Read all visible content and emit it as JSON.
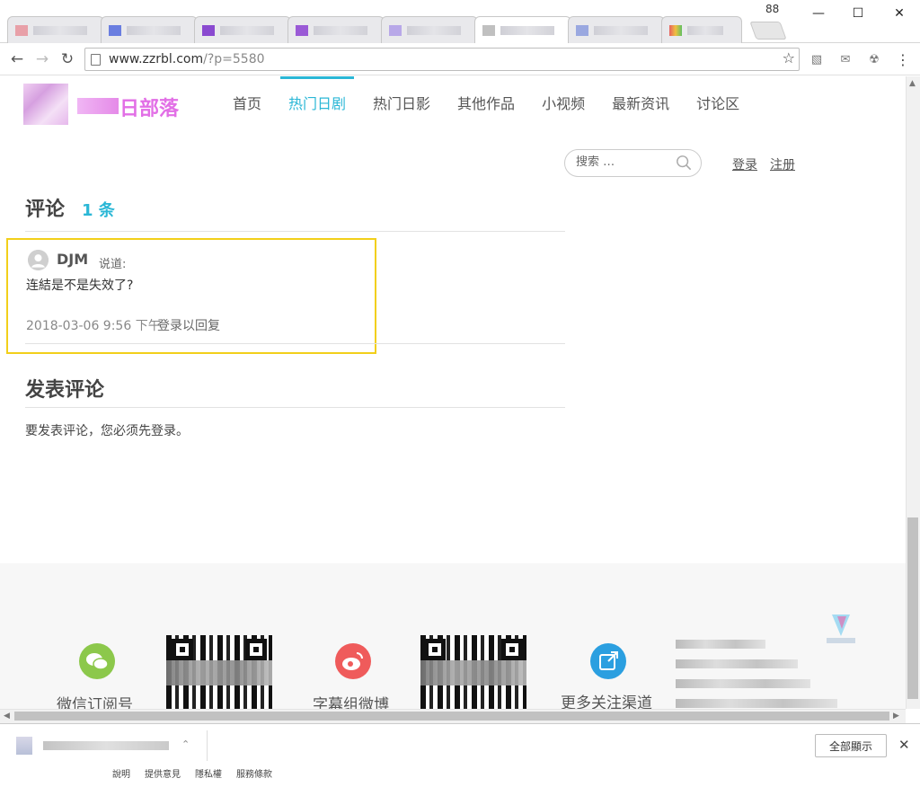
{
  "browser": {
    "tab_count": "88",
    "url_host": "www.zzrbl.com",
    "url_path": "/?p=5580",
    "window_controls": {
      "minimize_icon": "minimize-icon",
      "maximize_icon": "maximize-icon",
      "close_icon": "close-icon"
    }
  },
  "site": {
    "logo_text": "日部落",
    "nav": [
      {
        "label": "首页",
        "active": false
      },
      {
        "label": "热门日剧",
        "active": true
      },
      {
        "label": "热门日影",
        "active": false
      },
      {
        "label": "其他作品",
        "active": false
      },
      {
        "label": "小视频",
        "active": false
      },
      {
        "label": "最新资讯",
        "active": false
      },
      {
        "label": "讨论区",
        "active": false
      }
    ],
    "accent_color": "#2bb7d6",
    "logo_color": "#e26fe6"
  },
  "search": {
    "placeholder": "搜索 …"
  },
  "auth": {
    "login": "登录",
    "register": "注册"
  },
  "comments": {
    "title": "评论",
    "count": "1 条",
    "items": [
      {
        "author": "DJM",
        "says": "说道:",
        "body": "连結是不是失效了?",
        "date": "2018-03-06 9:56 下午",
        "reply": "登录以回复"
      }
    ],
    "highlight_color": "#f2cf1a"
  },
  "post_comment": {
    "title": "发表评论",
    "note": "要发表评论，您必须先登录。"
  },
  "footer": {
    "wechat_label": "微信订阅号",
    "weibo_label": "字幕组微博",
    "more_label": "更多关注渠道"
  },
  "download_bar": {
    "show_all": "全部顯示",
    "bottom_links": [
      "說明",
      "提供意見",
      "隱私權",
      "服務條款"
    ]
  }
}
